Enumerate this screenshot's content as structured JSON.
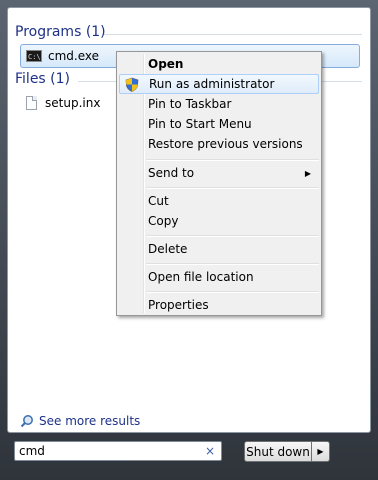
{
  "results": {
    "programs_header": "Programs (1)",
    "program_items": [
      {
        "label": "cmd.exe",
        "icon": "cmd-icon"
      }
    ],
    "files_header": "Files (1)",
    "file_items": [
      {
        "label": "setup.inx",
        "icon": "file-icon"
      }
    ],
    "see_more": "See more results",
    "cmd_icon_text": "C:\\"
  },
  "search": {
    "value": "cmd",
    "clear_icon": "×"
  },
  "shutdown": {
    "label": "Shut down",
    "arrow": "▶"
  },
  "context_menu": {
    "items": [
      {
        "label": "Open"
      },
      {
        "label": "Run as administrator"
      },
      {
        "label": "Pin to Taskbar"
      },
      {
        "label": "Pin to Start Menu"
      },
      {
        "label": "Restore previous versions"
      },
      {
        "label": "Send to"
      },
      {
        "label": "Cut"
      },
      {
        "label": "Copy"
      },
      {
        "label": "Delete"
      },
      {
        "label": "Open file location"
      },
      {
        "label": "Properties"
      }
    ],
    "submenu_arrow": "▶"
  },
  "colors": {
    "accent": "#1e3287",
    "selection": "#d5e8fa",
    "shield_blue": "#2f6fd6",
    "shield_yellow": "#f2c21b"
  }
}
